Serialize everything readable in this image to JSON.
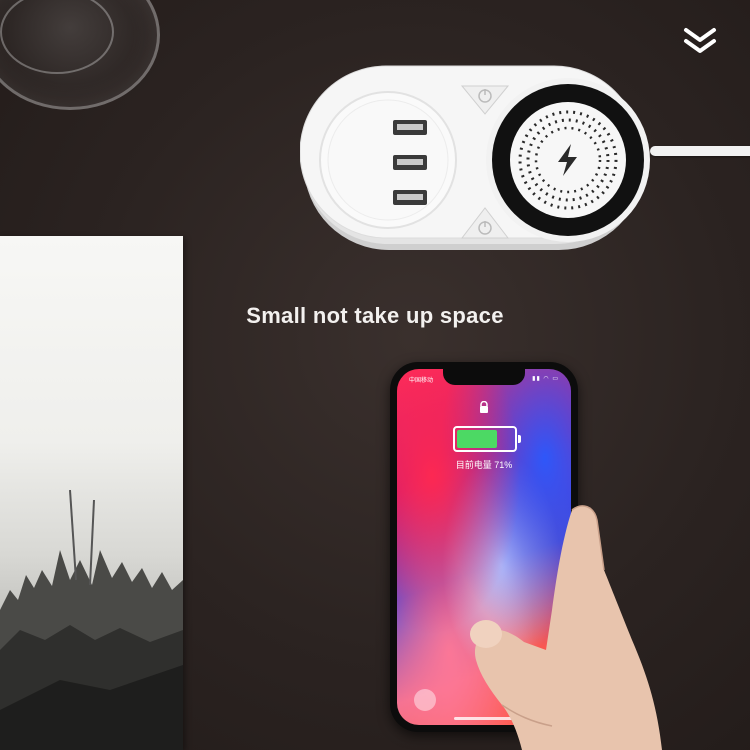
{
  "caption": "Small  not take up space",
  "phone": {
    "carrier": "中国移动",
    "status_icons": "▮▮ ◠ ▭",
    "charge_text": "目前电量 71%",
    "battery_percent": 71
  },
  "icons": {
    "chevron": "double-chevron-down-icon",
    "lightning": "lightning-bolt-icon",
    "power": "power-icon",
    "lock": "lock-icon",
    "flashlight": "flashlight-icon"
  },
  "colors": {
    "background": "#2b2321",
    "charger_body": "#f4f4f4",
    "charger_ring": "#111111",
    "battery_green": "#4cd964"
  }
}
